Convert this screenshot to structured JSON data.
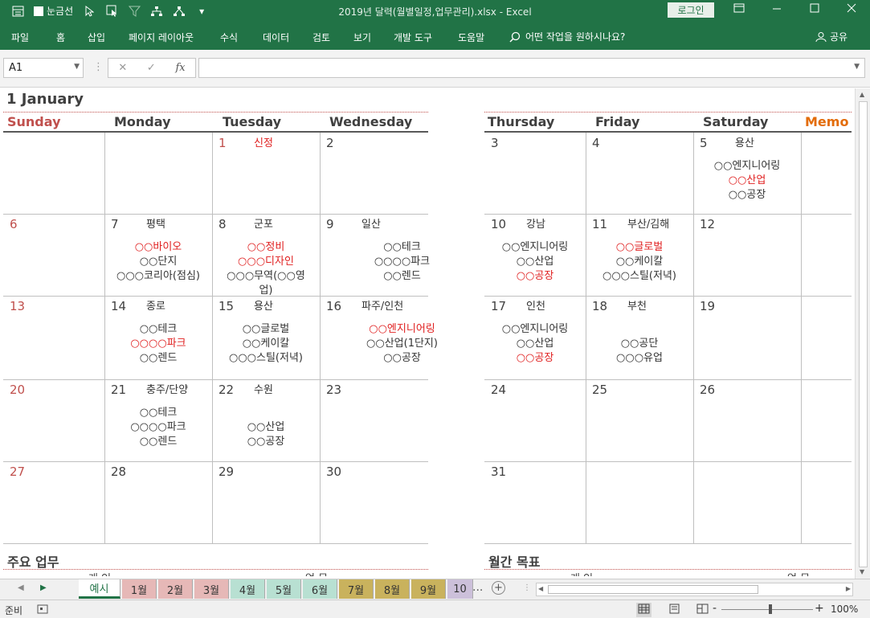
{
  "titlebar": {
    "gridlines_label": "눈금선",
    "title": "2019년 달력(월별일정,업무관리).xlsx  -  Excel",
    "login": "로그인"
  },
  "menu": {
    "items": [
      "파일",
      "홈",
      "삽입",
      "페이지 레이아웃",
      "수식",
      "데이터",
      "검토",
      "보기",
      "개발 도구",
      "도움말"
    ],
    "tell_me": "어떤 작업을 원하시나요?",
    "share": "공유"
  },
  "formula": {
    "name_box": "A1",
    "fx": "fx",
    "value": ""
  },
  "calendar": {
    "month_title": "1 January",
    "days": [
      "Sunday",
      "Monday",
      "Tuesday",
      "Wednesday",
      "Thursday",
      "Friday",
      "Saturday",
      "Memo"
    ],
    "weeks": [
      [
        {
          "d": ""
        },
        {
          "d": ""
        },
        {
          "d": "1",
          "loc": "신정",
          "red": true
        },
        {
          "d": "2"
        },
        {
          "d": "3"
        },
        {
          "d": "4"
        },
        {
          "d": "5",
          "loc": "용산",
          "items": [
            {
              "t": "○○엔지니어링"
            },
            {
              "t": "○○산업",
              "r": true
            },
            {
              "t": "○○공장"
            }
          ]
        }
      ],
      [
        {
          "d": "6",
          "red": true
        },
        {
          "d": "7",
          "loc": "평택",
          "items": [
            {
              "t": "○○바이오",
              "r": true
            },
            {
              "t": "○○단지"
            },
            {
              "t": "○○○코리아(점심)"
            }
          ]
        },
        {
          "d": "8",
          "loc": "군포",
          "items": [
            {
              "t": "○○정비",
              "r": true
            },
            {
              "t": "○○○디자인",
              "r": true
            },
            {
              "t": "○○○무역(○○영"
            },
            {
              "t": "업)"
            }
          ]
        },
        {
          "d": "9",
          "loc": "일산",
          "items": [
            {
              "t": "○○테크"
            },
            {
              "t": "○○○○파크"
            },
            {
              "t": "○○렌드"
            }
          ]
        },
        {
          "d": "10",
          "loc": "강남",
          "items": [
            {
              "t": "○○엔지니어링"
            },
            {
              "t": "○○산업"
            },
            {
              "t": "○○공장",
              "r": true
            }
          ]
        },
        {
          "d": "11",
          "loc": "부산/김해",
          "items": [
            {
              "t": "○○글로벌",
              "r": true
            },
            {
              "t": "○○케이칼"
            },
            {
              "t": "○○○스틸(저녁)"
            }
          ]
        },
        {
          "d": "12"
        }
      ],
      [
        {
          "d": "13",
          "red": true
        },
        {
          "d": "14",
          "loc": "종로",
          "items": [
            {
              "t": "○○테크"
            },
            {
              "t": "○○○○파크",
              "r": true
            },
            {
              "t": "○○렌드"
            }
          ]
        },
        {
          "d": "15",
          "loc": "용산",
          "items": [
            {
              "t": "○○글로벌"
            },
            {
              "t": "○○케이칼"
            },
            {
              "t": "○○○스틸(저녁)"
            }
          ]
        },
        {
          "d": "16",
          "loc": "파주/인천",
          "items": [
            {
              "t": "○○엔지니어링",
              "r": true
            },
            {
              "t": "○○산업(1단지)"
            },
            {
              "t": "○○공장"
            }
          ]
        },
        {
          "d": "17",
          "loc": "인천",
          "items": [
            {
              "t": "○○엔지니어링"
            },
            {
              "t": "○○산업"
            },
            {
              "t": "○○공장",
              "r": true
            }
          ]
        },
        {
          "d": "18",
          "loc": "부천",
          "items": [
            {
              "t": ""
            },
            {
              "t": "○○공단"
            },
            {
              "t": "○○○유업"
            }
          ]
        },
        {
          "d": "19"
        }
      ],
      [
        {
          "d": "20",
          "red": true
        },
        {
          "d": "21",
          "loc": "충주/단양",
          "items": [
            {
              "t": "○○테크"
            },
            {
              "t": "○○○○파크"
            },
            {
              "t": "○○렌드"
            }
          ]
        },
        {
          "d": "22",
          "loc": "수원",
          "items": [
            {
              "t": ""
            },
            {
              "t": "○○산업"
            },
            {
              "t": "○○공장"
            }
          ]
        },
        {
          "d": "23"
        },
        {
          "d": "24"
        },
        {
          "d": "25"
        },
        {
          "d": "26"
        }
      ],
      [
        {
          "d": "27",
          "red": true
        },
        {
          "d": "28"
        },
        {
          "d": "29"
        },
        {
          "d": "30"
        },
        {
          "d": "31"
        },
        {
          "d": ""
        },
        {
          "d": ""
        }
      ]
    ],
    "section_left": "주요 업무",
    "section_right": "월간 목표",
    "sub_left_a": "개 인",
    "sub_left_b": "업 무",
    "sub_right_a": "개 인",
    "sub_right_b": "업 무"
  },
  "tabs": {
    "items": [
      {
        "label": "예시",
        "bg": "#ffffff",
        "active": true
      },
      {
        "label": "1월",
        "bg": "#e6b8b7"
      },
      {
        "label": "2월",
        "bg": "#e6b8b7"
      },
      {
        "label": "3월",
        "bg": "#e6b8b7"
      },
      {
        "label": "4월",
        "bg": "#b8e0d2"
      },
      {
        "label": "5월",
        "bg": "#b8e0d2"
      },
      {
        "label": "6월",
        "bg": "#b8e0d2"
      },
      {
        "label": "7월",
        "bg": "#c9b25d"
      },
      {
        "label": "8월",
        "bg": "#c9b25d"
      },
      {
        "label": "9월",
        "bg": "#c9b25d"
      },
      {
        "label": "10",
        "bg": "#ccc0da"
      }
    ],
    "more": "...",
    "add": "+"
  },
  "status": {
    "ready": "준비",
    "zoom": "100%",
    "minus": "-",
    "plus": "+"
  },
  "colors": {
    "excel_green": "#217346",
    "sunday_red": "#c0504d",
    "memo_orange": "#e36c09"
  }
}
